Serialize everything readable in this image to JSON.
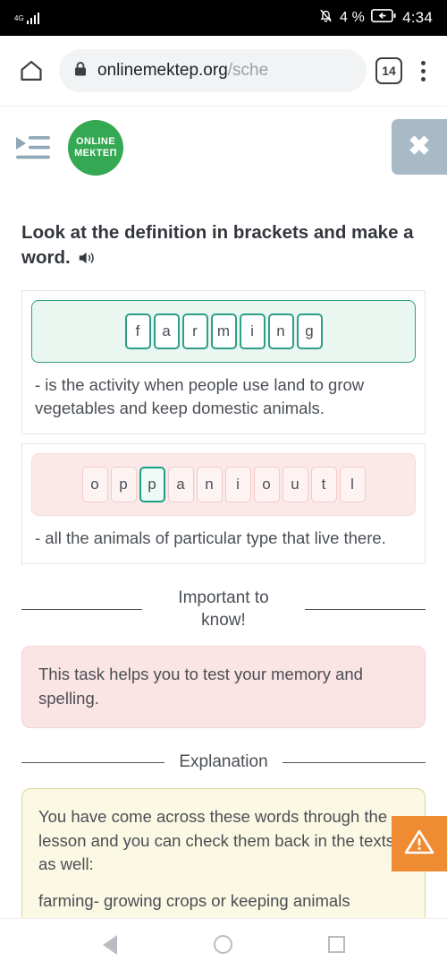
{
  "status_bar": {
    "network_label": "4G",
    "signal_icon": "signal-bars-icon",
    "mute_icon": "bell-muted-icon",
    "battery_percent": "4 %",
    "battery_icon": "battery-charging-icon",
    "clock": "4:34"
  },
  "browser": {
    "home_icon": "home-icon",
    "lock_icon": "lock-icon",
    "url_visible": "onlinemektep.org",
    "url_dim": "/sche",
    "tab_count": "14",
    "menu_icon": "kebab-menu-icon"
  },
  "app_header": {
    "indent_icon": "indent-menu-icon",
    "logo_line1": "ONLINE",
    "logo_line2": "МЕКТЕП",
    "logo_color": "#34a853",
    "list_icon": "list-view-icon",
    "close_label": "✖",
    "close_bg": "#a8bac6"
  },
  "task": {
    "title": "Look at the definition in brackets and make a word.",
    "audio_icon": "speaker-icon"
  },
  "words": [
    {
      "id": "word-farming",
      "state": "solved",
      "strip_style": "green",
      "letters": [
        "f",
        "a",
        "r",
        "m",
        "i",
        "n",
        "g"
      ],
      "selected_index": -1,
      "definition": "- is the activity when people use land to grow vegetables and keep domestic animals."
    },
    {
      "id": "word-population",
      "state": "scrambled",
      "strip_style": "pink",
      "letters": [
        "o",
        "p",
        "p",
        "a",
        "n",
        "i",
        "o",
        "u",
        "t",
        "l"
      ],
      "selected_index": 2,
      "definition": "- all the animals of particular type that live there."
    }
  ],
  "important": {
    "heading": "Important to know!",
    "body": "This task helps you to test your memory and spelling."
  },
  "explanation": {
    "heading": "Explanation",
    "paragraph1": "You have come across these words through the lesson and you can check them back in the texts as well:",
    "paragraph2": "farming- growing crops or keeping animals"
  },
  "warning_badge": {
    "icon": "warning-triangle-icon",
    "color": "#ef8b33"
  },
  "nav_bar": {
    "back_icon": "back-triangle-icon",
    "home_icon": "home-circle-icon",
    "recents_icon": "recents-square-icon"
  },
  "colors": {
    "accent_green": "#2e9e86",
    "brand_green": "#34a853",
    "pink_tile_border": "#f3c9c9",
    "warning_orange": "#ef8b33"
  }
}
